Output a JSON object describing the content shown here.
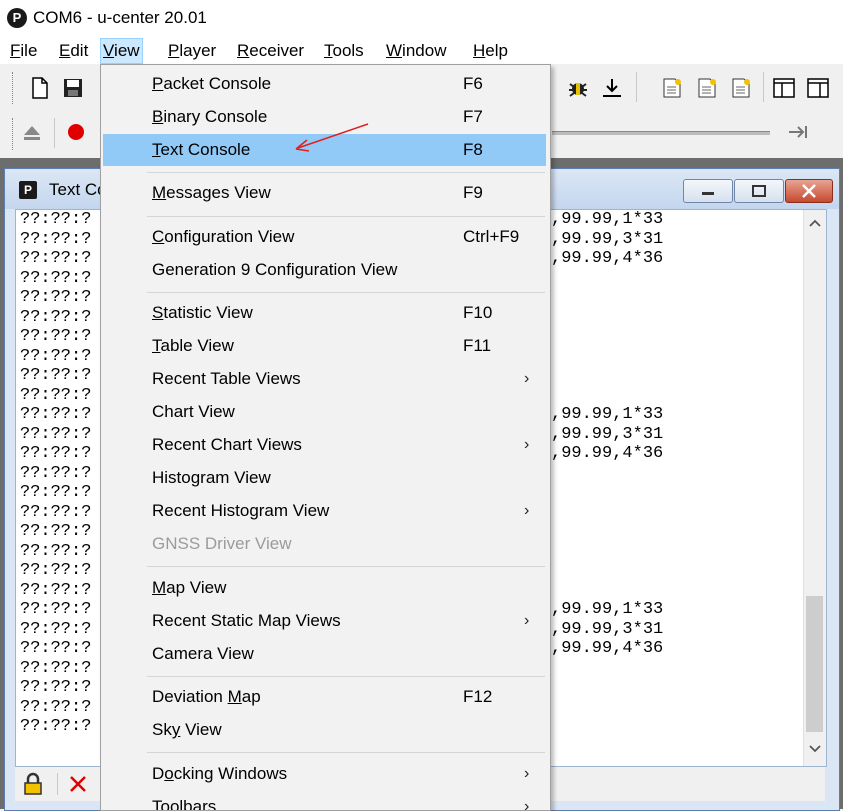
{
  "window": {
    "logo": "P",
    "title": "COM6 - u-center 20.01"
  },
  "menubar": [
    {
      "label": "File",
      "u": "F",
      "rest": "ile"
    },
    {
      "label": "Edit",
      "u": "E",
      "rest": "dit"
    },
    {
      "label": "View",
      "u": "V",
      "rest": "iew"
    },
    {
      "label": "Player",
      "u": "P",
      "rest": "layer"
    },
    {
      "label": "Receiver",
      "u": "R",
      "rest": "eceiver"
    },
    {
      "label": "Tools",
      "u": "T",
      "rest": "ools"
    },
    {
      "label": "Window",
      "u": "W",
      "rest": "indow"
    },
    {
      "label": "Help",
      "u": "H",
      "rest": "elp"
    }
  ],
  "child_window": {
    "title": "Text Co"
  },
  "console": {
    "left_prefix": "??:??:?",
    "right_lines": [
      ",99.99,1*33",
      ",99.99,3*31",
      ",99.99,4*36"
    ]
  },
  "view_menu": {
    "items": [
      {
        "u": "P",
        "rest": "acket Console",
        "label": "Packet Console",
        "shortcut": "F6"
      },
      {
        "u": "B",
        "rest": "inary Console",
        "label": "Binary Console",
        "shortcut": "F7"
      },
      {
        "u": "T",
        "rest": "ext Console",
        "label": "Text Console",
        "shortcut": "F8",
        "selected": true
      },
      {
        "u": "M",
        "rest": "essages View",
        "label": "Messages View",
        "shortcut": "F9"
      },
      {
        "u": "C",
        "rest": "onfiguration View",
        "label": "Configuration View",
        "shortcut": "Ctrl+F9"
      },
      {
        "label": "Generation 9 Configuration View",
        "shortcut": ""
      },
      {
        "u": "S",
        "rest": "tatistic View",
        "label": "Statistic View",
        "shortcut": "F10"
      },
      {
        "u": "T",
        "rest": "able View",
        "label": "Table View",
        "shortcut": "F11"
      },
      {
        "label": "Recent Table Views",
        "submenu": true
      },
      {
        "label": "Chart View"
      },
      {
        "label": "Recent Chart Views",
        "submenu": true
      },
      {
        "label": "Histogram View"
      },
      {
        "label": "Recent Histogram View",
        "submenu": true
      },
      {
        "label": "GNSS Driver View",
        "disabled": true
      },
      {
        "u": "M",
        "rest": "ap View",
        "label": "Map View"
      },
      {
        "label": "Recent Static Map Views",
        "submenu": true
      },
      {
        "label": "Camera View"
      },
      {
        "label": "Deviation Map",
        "pre": "Deviation ",
        "u": "M",
        "rest": "ap",
        "shortcut": "F12"
      },
      {
        "label": "Sky View",
        "pre": "Sk",
        "u": "y",
        "rest": " View"
      },
      {
        "label": "Docking Windows",
        "pre": "D",
        "u": "o",
        "rest": "cking Windows",
        "submenu": true
      },
      {
        "label": "Toolbars",
        "submenu": true
      }
    ]
  },
  "icons": {
    "new": "new-file-icon",
    "save": "save-icon",
    "record": "record-icon",
    "eject": "eject-icon",
    "lock": "lock-icon",
    "delete": "delete-icon",
    "arrow": "annotation-arrow-icon"
  },
  "colors": {
    "menu_highlight": "#91c9f7",
    "record_red": "#e00000",
    "arrow_red": "#e02020"
  }
}
